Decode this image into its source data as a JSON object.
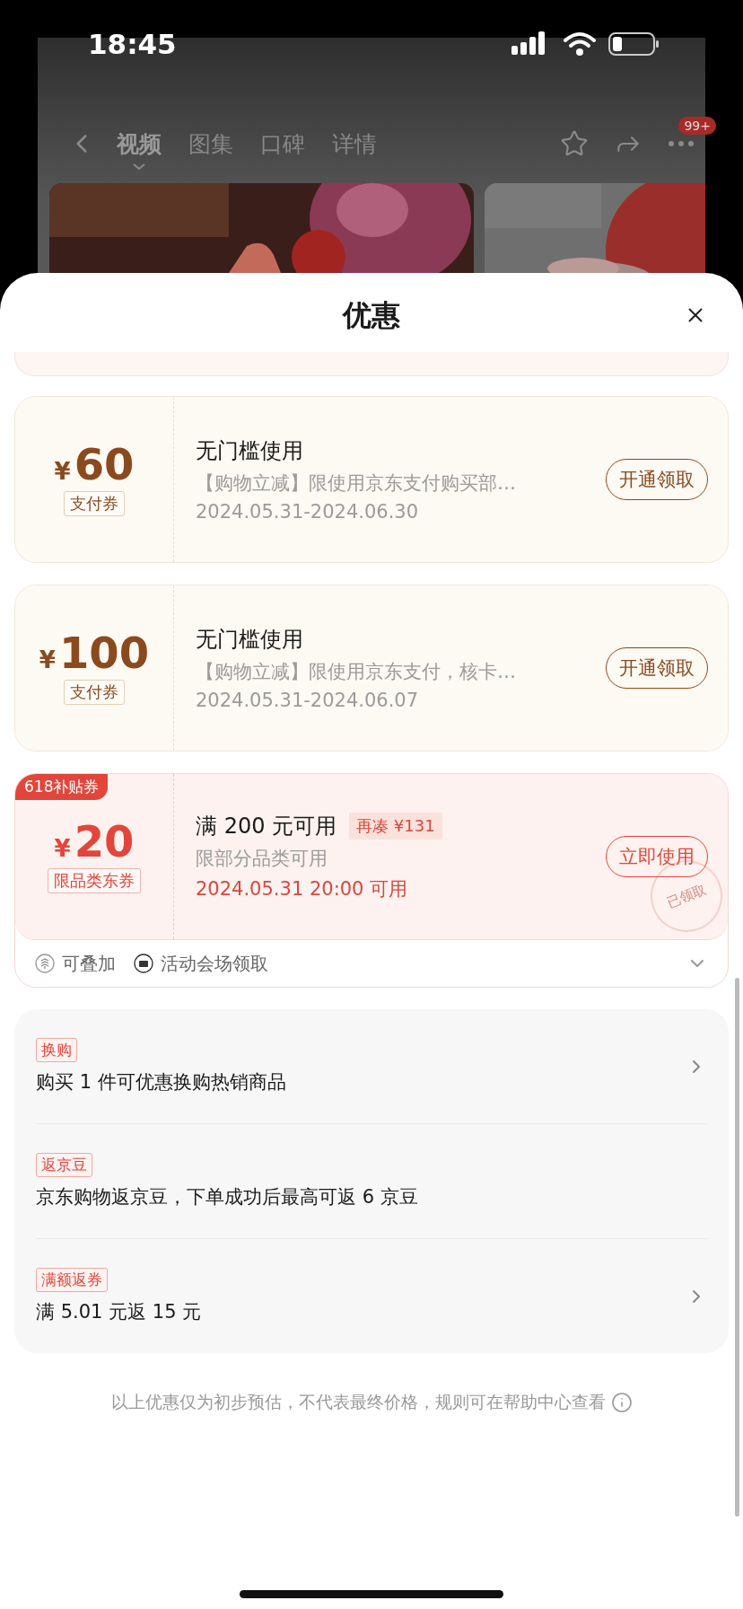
{
  "status_bar": {
    "time": "18:45"
  },
  "nav": {
    "tabs": [
      {
        "label": "视频",
        "selected": true
      },
      {
        "label": "图集",
        "selected": false
      },
      {
        "label": "口碑",
        "selected": false
      },
      {
        "label": "详情",
        "selected": false
      }
    ],
    "badge": "99+"
  },
  "sheet": {
    "title": "优惠"
  },
  "coupons": [
    {
      "kind": "pay",
      "currency": "¥",
      "amount": "60",
      "type_label": "支付券",
      "title": "无门槛使用",
      "description": "【购物立减】限使用京东支付购买部…",
      "date": "2024.05.31-2024.06.30",
      "button": "开通领取"
    },
    {
      "kind": "pay",
      "currency": "¥",
      "amount": "100",
      "type_label": "支付券",
      "title": "无门槛使用",
      "description": "【购物立减】限使用京东支付，核卡…",
      "date": "2024.05.31-2024.06.07",
      "button": "开通领取"
    },
    {
      "kind": "subsidy",
      "corner_tag": "618补贴券",
      "currency": "¥",
      "amount": "20",
      "type_label": "限品类东券",
      "title": "满 200 元可用",
      "extra_tag": "再凑 ¥131",
      "description": "限部分品类可用",
      "date": "2024.05.31 20:00 可用",
      "button": "立即使用",
      "stamp": "已领取",
      "features": [
        {
          "kind": "stack",
          "label": "可叠加"
        },
        {
          "kind": "ticket",
          "label": "活动会场领取"
        }
      ],
      "expanded": false
    }
  ],
  "promotions": [
    {
      "tag": "换购",
      "text": "购买 1 件可优惠换购热销商品",
      "arrow": true
    },
    {
      "tag": "返京豆",
      "text": "京东购物返京豆，下单成功后最高可返 6 京豆",
      "arrow": false
    },
    {
      "tag": "满额返券",
      "text": "满 5.01 元返 15 元",
      "arrow": true
    }
  ],
  "note": "以上优惠仅为初步预估，不代表最终价格，规则可在帮助中心查看"
}
